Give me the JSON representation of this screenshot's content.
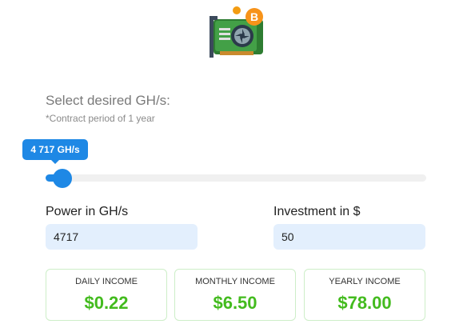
{
  "header": {
    "logo_icon": "gpu-bitcoin-icon",
    "title": "Select desired GH/s:",
    "subtitle": "*Contract period of 1 year"
  },
  "slider": {
    "tooltip": "4 717 GH/s",
    "level_fraction": 0.02,
    "accent_color": "#1e88e5"
  },
  "fields": {
    "power_label": "Power in GH/s",
    "power_value": "4717",
    "investment_label": "Investment in $",
    "investment_value": "50"
  },
  "income": {
    "value_color": "#43bb1e",
    "daily_label": "DAILY INCOME",
    "daily_value": "$0.22",
    "monthly_label": "MONTHLY INCOME",
    "monthly_value": "$6.50",
    "yearly_label": "YEARLY INCOME",
    "yearly_value": "$78.00"
  }
}
